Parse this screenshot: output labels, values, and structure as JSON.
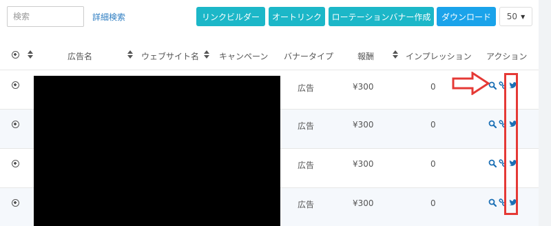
{
  "toolbar": {
    "search_placeholder": "検索",
    "advanced_search_label": "詳細検索",
    "buttons": [
      {
        "label": "リンクビルダー"
      },
      {
        "label": "オートリンク"
      },
      {
        "label": "ローテーションバナー作成"
      },
      {
        "label": "ダウンロード"
      }
    ],
    "per_page": {
      "value": "50"
    }
  },
  "table": {
    "columns": {
      "ad_name": "広告名",
      "website_name": "ウェブサイト名",
      "campaign": "キャンペーン",
      "banner_type": "バナータイプ",
      "reward": "報酬",
      "impressions": "インプレッション",
      "actions": "アクション"
    },
    "rows": [
      {
        "banner_type": "広告",
        "reward": "¥300",
        "impressions": "0"
      },
      {
        "banner_type": "広告",
        "reward": "¥300",
        "impressions": "0"
      },
      {
        "banner_type": "広告",
        "reward": "¥300",
        "impressions": "0"
      },
      {
        "banner_type": "広告",
        "reward": "¥300",
        "impressions": "0"
      }
    ],
    "row_icons": [
      "expand-row-icon",
      "search-icon",
      "link-icon",
      "twitter-icon"
    ]
  },
  "colors": {
    "teal_button": "#1cb7c8",
    "blue_button": "#1aa3ea",
    "action_icon": "#1a6fb5",
    "annotation_red": "#e53935"
  }
}
